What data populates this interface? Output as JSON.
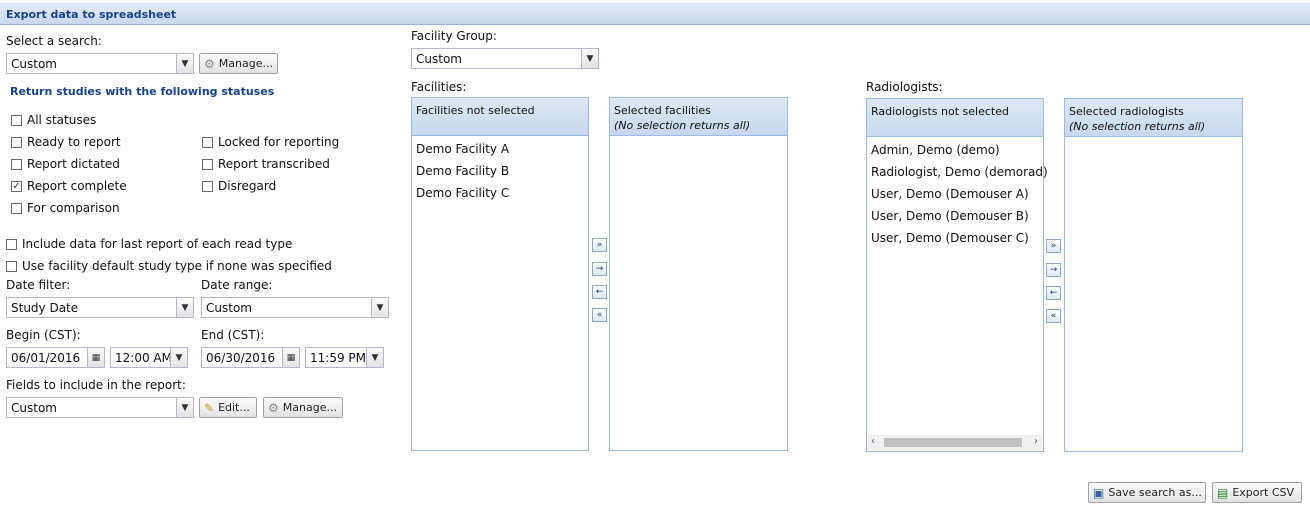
{
  "title": "Export data to spreadsheet",
  "search": {
    "label": "Select a search:",
    "value": "Custom",
    "manage_label": "Manage..."
  },
  "statuses": {
    "heading": "Return studies with the following statuses",
    "all": {
      "label": "All statuses",
      "checked": false
    },
    "ready": {
      "label": "Ready to report",
      "checked": false
    },
    "locked": {
      "label": "Locked for reporting",
      "checked": false
    },
    "dictated": {
      "label": "Report dictated",
      "checked": false
    },
    "transcribed": {
      "label": "Report transcribed",
      "checked": false
    },
    "complete": {
      "label": "Report complete",
      "checked": true
    },
    "disregard": {
      "label": "Disregard",
      "checked": false
    },
    "comparison": {
      "label": "For comparison",
      "checked": false
    }
  },
  "options": {
    "include_last": {
      "label": "Include data for last report of each read type",
      "checked": false
    },
    "facility_default": {
      "label": "Use facility default study type if none was specified",
      "checked": false
    }
  },
  "date_filter": {
    "label": "Date filter:",
    "value": "Study Date"
  },
  "date_range": {
    "label": "Date range:",
    "value": "Custom"
  },
  "begin": {
    "label": "Begin (CST):",
    "date": "06/01/2016",
    "time": "12:00 AM"
  },
  "end": {
    "label": "End (CST):",
    "date": "06/30/2016",
    "time": "11:59 PM"
  },
  "fields": {
    "label": "Fields to include in the report:",
    "value": "Custom",
    "edit_label": "Edit...",
    "manage_label": "Manage..."
  },
  "facility_group": {
    "label": "Facility Group:",
    "value": "Custom"
  },
  "facilities": {
    "label": "Facilities:",
    "not_selected_title": "Facilities not selected",
    "selected_title": "Selected facilities",
    "selected_note": "(No selection returns all)",
    "items": [
      "Demo Facility A",
      "Demo Facility B",
      "Demo Facility C"
    ]
  },
  "radiologists": {
    "label": "Radiologists:",
    "not_selected_title": "Radiologists not selected",
    "selected_title": "Selected radiologists",
    "selected_note": "(No selection returns all)",
    "items": [
      "Admin, Demo (demo)",
      "Radiologist, Demo (demorad)",
      "User, Demo (Demouser A)",
      "User, Demo (Demouser B)",
      "User, Demo (Demouser C)"
    ]
  },
  "footer": {
    "save_label": "Save search as...",
    "export_label": "Export CSV"
  },
  "icons": {
    "gear": "gear-icon",
    "pencil": "pencil-icon",
    "calendar": "calendar-icon",
    "save": "floppy-disk-icon",
    "export": "spreadsheet-icon",
    "add_all": "double-arrow-right-icon",
    "add": "arrow-right-icon",
    "remove": "arrow-left-icon",
    "remove_all": "double-arrow-left-icon"
  },
  "colors": {
    "accent": "#15428b",
    "header_bg": "#c8d8ee",
    "panel_border": "#99bbe8"
  }
}
